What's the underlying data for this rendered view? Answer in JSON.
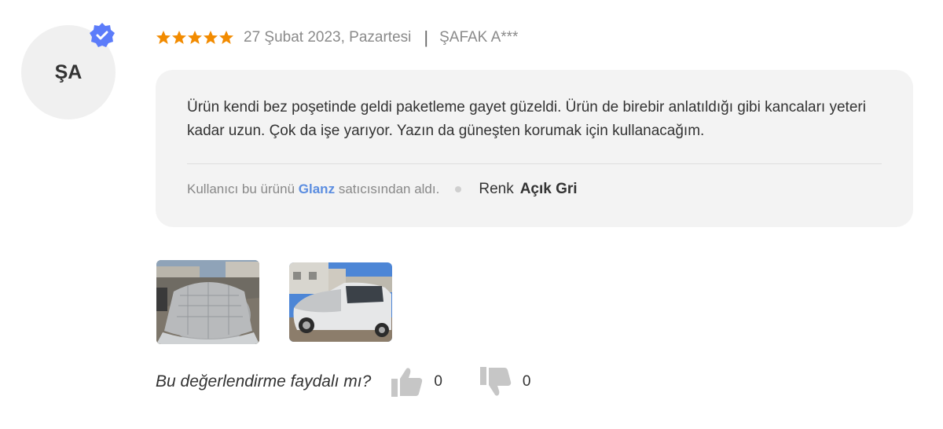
{
  "avatar": {
    "initials": "ŞA",
    "verified": true
  },
  "review": {
    "rating": 5,
    "max_rating": 5,
    "date": "27 Şubat 2023, Pazartesi",
    "separator": "|",
    "author": "ŞAFAK A***",
    "text": "Ürün kendi bez poşetinde geldi paketleme gayet güzeldi. Ürün de birebir anlatıldığı gibi kancaları yeteri kadar uzun. Çok da işe yarıyor. Yazın da güneşten korumak için kullanacağım.",
    "seller_prefix": "Kullanıcı bu ürünü",
    "seller_name": "Glanz",
    "seller_suffix": "satıcısından aldı.",
    "attribute_key": "Renk",
    "attribute_value": "Açık Gri"
  },
  "photos": [
    {
      "name": "car-cover-photo-1"
    },
    {
      "name": "car-cover-photo-2"
    }
  ],
  "helpful": {
    "question": "Bu değerlendirme faydalı mı?",
    "likes": "0",
    "dislikes": "0"
  },
  "colors": {
    "star": "#f28b00",
    "verified_badge": "#5c7cfa",
    "seller_link": "#5b8de0",
    "bubble_bg": "#f3f3f3",
    "thumb_icon": "#c6c6c6"
  }
}
